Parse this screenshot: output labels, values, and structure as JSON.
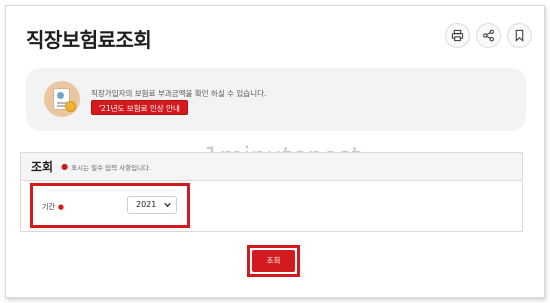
{
  "page": {
    "title": "직장보험료조회"
  },
  "toolbar": {
    "icons": [
      "print-icon",
      "share-icon",
      "bookmark-icon"
    ]
  },
  "notice": {
    "text": "직장가입자의 보험료 부과금액을 확인 하실 수 있습니다.",
    "button_label": "'21년도 보험료 인상 안내"
  },
  "watermark": "1minutepost",
  "search": {
    "title": "조회",
    "required_mark": "●",
    "required_note": "표시는 필수 입력 사항입니다.",
    "period_label": "기간",
    "period_required": "●",
    "year_value": "2021",
    "submit_label": "조회"
  },
  "colors": {
    "accent": "#d31a1f",
    "panel_bg": "#f3f3f3",
    "border": "#dadada"
  }
}
